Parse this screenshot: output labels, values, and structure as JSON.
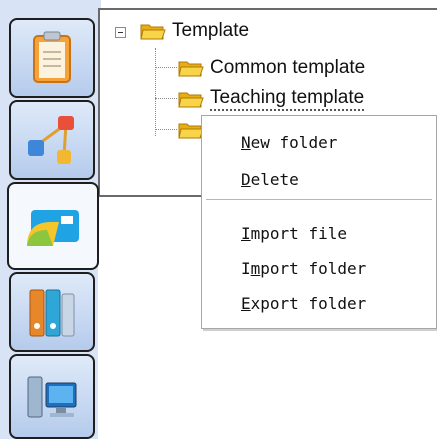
{
  "tree": {
    "root": {
      "label": "Template",
      "expanded": true
    },
    "children": [
      {
        "label": "Common template"
      },
      {
        "label": "Teaching template",
        "selected": true
      },
      {
        "label": ""
      }
    ]
  },
  "context_menu": {
    "items": [
      {
        "accel": "N",
        "rest": "ew folder"
      },
      {
        "accel": "D",
        "rest": "elete"
      },
      {
        "accel": "I",
        "rest": "mport file"
      },
      {
        "pre": "I",
        "accel": "m",
        "rest": "port folder"
      },
      {
        "accel": "E",
        "rest": "xport folder"
      }
    ]
  },
  "tabs": [
    {
      "icon": "clipboard-icon"
    },
    {
      "icon": "network-nodes-icon"
    },
    {
      "icon": "folder-card-icon",
      "active": true
    },
    {
      "icon": "binders-icon"
    },
    {
      "icon": "computer-icon"
    }
  ],
  "colors": {
    "tabstrip_bg": "#d8e4f6",
    "folder_yellow": "#f3c526",
    "menu_border": "#a6a6a6"
  }
}
